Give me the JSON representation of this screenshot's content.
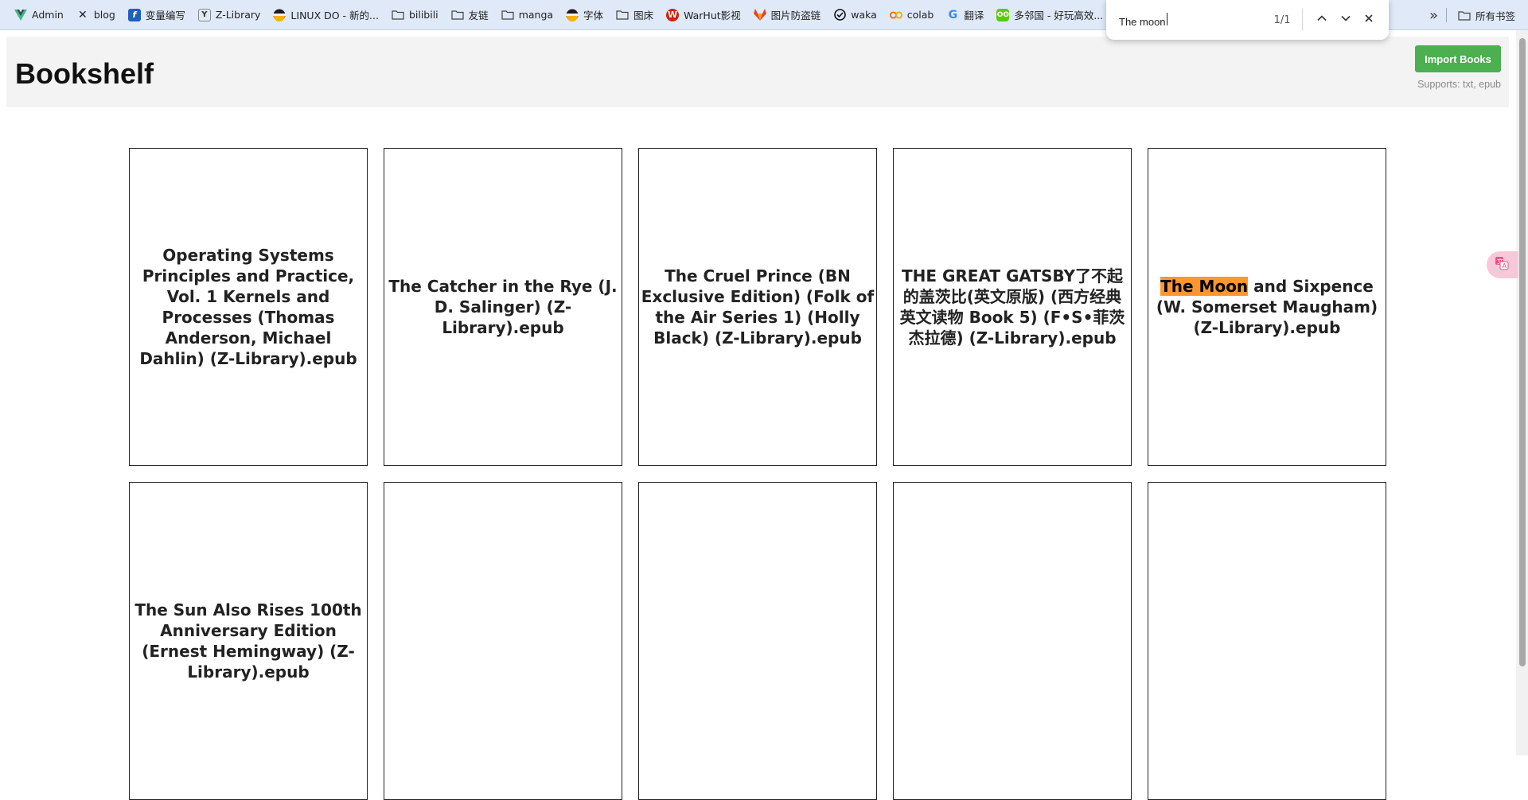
{
  "bookmarks": [
    {
      "label": "Admin",
      "icon": "vue-icon",
      "color": "#41b883"
    },
    {
      "label": "blog",
      "icon": "x-icon",
      "color": "#222222"
    },
    {
      "label": "变量编写",
      "icon": "wiki-icon",
      "color": "#1f5fbf"
    },
    {
      "label": "Z-Library",
      "icon": "zlib-icon",
      "color": "#333333"
    },
    {
      "label": "LINUX DO - 新的...",
      "icon": "linuxdo-icon",
      "color": "#f4b400"
    },
    {
      "label": "bilibili",
      "icon": "folder-icon",
      "color": "#444444"
    },
    {
      "label": "友链",
      "icon": "folder-icon",
      "color": "#444444"
    },
    {
      "label": "manga",
      "icon": "folder-icon",
      "color": "#444444"
    },
    {
      "label": "字体",
      "icon": "linuxdo-icon",
      "color": "#f4b400"
    },
    {
      "label": "图床",
      "icon": "folder-icon",
      "color": "#444444"
    },
    {
      "label": "WarHut影视",
      "icon": "warhut-icon",
      "color": "#d81e06"
    },
    {
      "label": "图片防盗链",
      "icon": "fox-icon",
      "color": "#e24329"
    },
    {
      "label": "waka",
      "icon": "waka-icon",
      "color": "#111111"
    },
    {
      "label": "colab",
      "icon": "colab-icon",
      "color": "#f9ab00"
    },
    {
      "label": "翻译",
      "icon": "google-icon",
      "color": "#4285f4"
    },
    {
      "label": "多邻国 - 好玩高效...",
      "icon": "duolingo-icon",
      "color": "#58cc02"
    }
  ],
  "bookmarks_overflow": "»",
  "all_bookmarks": "所有书签",
  "find": {
    "query": "The moon",
    "count": "1/1"
  },
  "header": {
    "title": "Bookshelf",
    "import_label": "Import Books",
    "supports": "Supports: txt, epub"
  },
  "books": [
    {
      "title": "Operating Systems Principles and Practice, Vol. 1 Kernels and Processes (Thomas Anderson, Michael Dahlin) (Z-Library).epub"
    },
    {
      "title": "The Catcher in the Rye (J. D. Salinger) (Z-Library).epub"
    },
    {
      "title": "The Cruel Prince (BN Exclusive Edition) (Folk of the Air Series 1) (Holly Black) (Z-Library).epub"
    },
    {
      "title": "THE GREAT GATSBY了不起的盖茨比(英文原版) (西方经典英文读物 Book 5) (F•S•菲茨杰拉德) (Z-Library).epub"
    },
    {
      "title_highlight": "The Moon",
      "title_rest": " and Sixpence (W. Somerset Maugham) (Z-Library).epub"
    },
    {
      "title": "The Sun Also Rises 100th Anniversary Edition (Ernest Hemingway) (Z-Library).epub"
    },
    {
      "title": ""
    },
    {
      "title": ""
    },
    {
      "title": ""
    },
    {
      "title": ""
    }
  ],
  "colors": {
    "import_button": "#4caf50",
    "highlight": "#ff9632",
    "bookmarks_bar": "#dfe9f8"
  }
}
